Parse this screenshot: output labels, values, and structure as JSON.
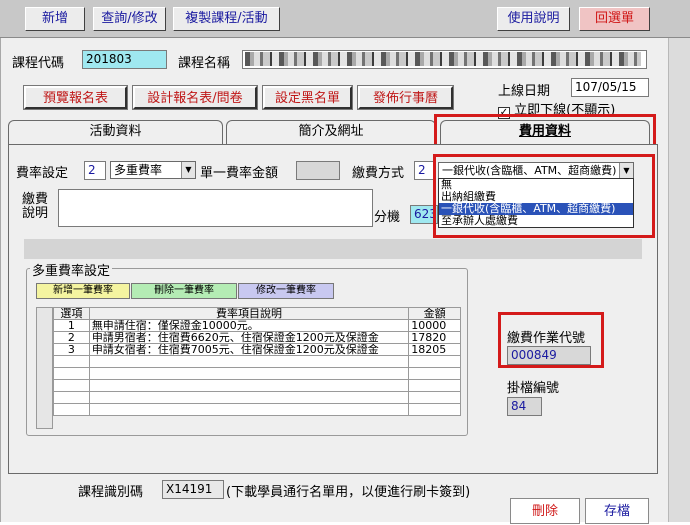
{
  "toolbar": {
    "new": "新增",
    "query": "查詢/修改",
    "copy": "複製課程/活動",
    "help": "使用說明",
    "menu": "回選單"
  },
  "course": {
    "code_label": "課程代碼",
    "code_value": "201803",
    "name_label": "課程名稱",
    "online_date_label": "上線日期",
    "online_date_value": "107/05/15",
    "offline_label": "立即下線(不顯示)"
  },
  "actions": {
    "preview": "預覽報名表",
    "design": "設計報名表/問卷",
    "blacklist": "設定黑名單",
    "publish": "發佈行事曆"
  },
  "tabs": [
    {
      "label": "活動資料"
    },
    {
      "label": "簡介及網址"
    },
    {
      "label": "費用資料"
    }
  ],
  "fee": {
    "setting_label": "費率設定",
    "setting_code": "2",
    "setting_value": "多重費率",
    "single_label": "單一費率金額",
    "method_label": "繳費方式",
    "method_code": "2",
    "method_value": "一銀代收(含臨櫃、ATM、超商繳費)",
    "note_label_1": "繳費",
    "note_label_2": "說明",
    "ext_label": "分機",
    "ext_value": "6233"
  },
  "method_options": [
    "無",
    "出納組繳費",
    "一銀代收(含臨櫃、ATM、超商繳費)",
    "至承辦人處繳費"
  ],
  "multi": {
    "section_label": "多重費率設定",
    "add": "新增一筆費率",
    "delete": "刪除一筆費率",
    "edit": "修改一筆費率",
    "columns": [
      "選項",
      "費率項目說明",
      "金額"
    ],
    "rows": [
      {
        "no": "1",
        "desc": "無申請住宿：僅保證金10000元。",
        "amount": "10000"
      },
      {
        "no": "2",
        "desc": "申請男宿者：住宿費6620元、住宿保證金1200元及保證金",
        "amount": "17820"
      },
      {
        "no": "3",
        "desc": "申請女宿者：住宿費7005元、住宿保證金1200元及保證金",
        "amount": "18205"
      }
    ]
  },
  "payment": {
    "code_label": "繳費作業代號",
    "code_value": "000849",
    "archive_label": "掛檔編號",
    "archive_value": "84"
  },
  "footer": {
    "id_label": "課程識別碼",
    "id_value": "X14191",
    "id_note": "(下載學員通行名單用，以便進行刷卡簽到)",
    "delete": "刪除",
    "save": "存檔"
  },
  "colors": {
    "highlight": "#d41a1a",
    "cyan_field": "#9fe8f0",
    "selected_option": "#2a52b8"
  }
}
